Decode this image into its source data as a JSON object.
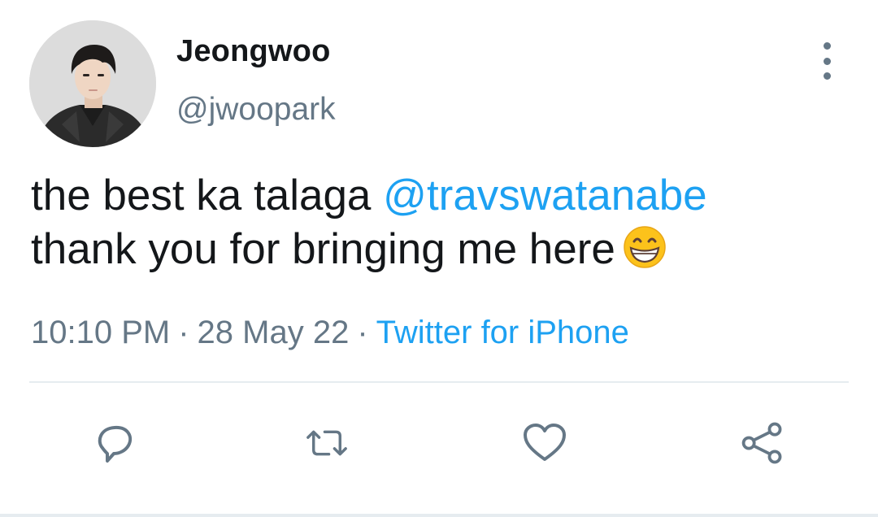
{
  "tweet": {
    "author": {
      "display_name": "Jeongwoo",
      "handle": "@jwoopark",
      "avatar_icon": "profile-photo"
    },
    "text": {
      "line1_prefix": "the best ka talaga ",
      "line1_mention": "@travswatanabe",
      "line2": "thank you for bringing me here",
      "emoji": "grinning-face-with-smiling-eyes"
    },
    "meta": {
      "time": "10:10 PM",
      "separator": "·",
      "date": "28 May 22",
      "source": "Twitter for iPhone"
    },
    "actions": {
      "reply_icon": "comment-icon",
      "retweet_icon": "retweet-icon",
      "like_icon": "heart-icon",
      "share_icon": "share-icon",
      "more_icon": "more-vertical-icon"
    }
  },
  "colors": {
    "text": "#14171a",
    "secondary": "#657786",
    "accent": "#1da1f2",
    "divider": "#e6ecf0"
  }
}
